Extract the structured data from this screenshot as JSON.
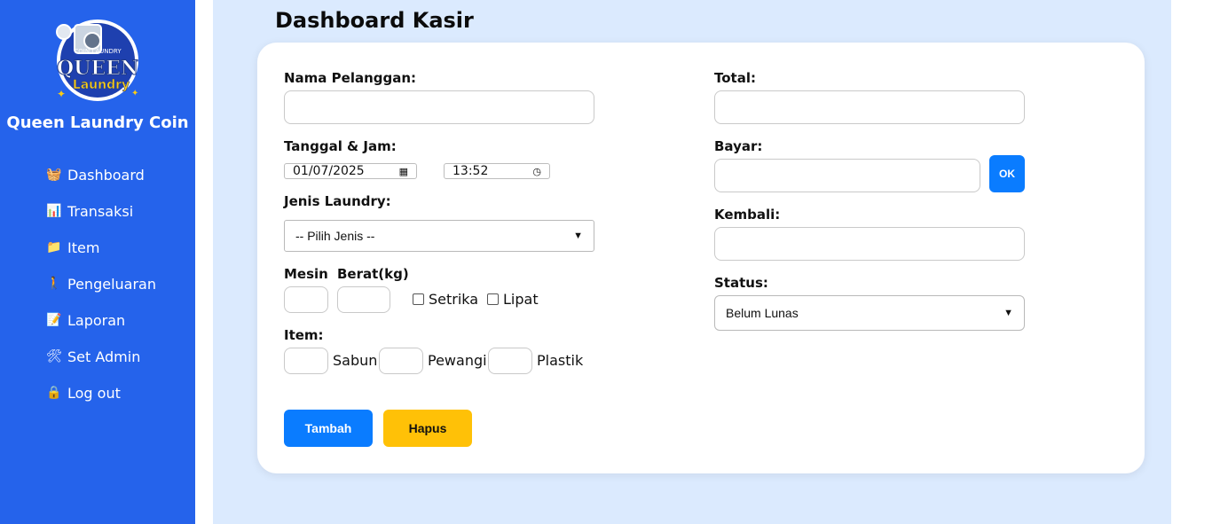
{
  "sidebar": {
    "brand": "Queen Laundry Coin",
    "items": [
      {
        "label": "Dashboard",
        "icon": "washing-basket-icon"
      },
      {
        "label": "Transaksi",
        "icon": "bar-chart-icon"
      },
      {
        "label": "Item",
        "icon": "folder-icon"
      },
      {
        "label": "Pengeluaran",
        "icon": "person-walking-icon"
      },
      {
        "label": "Laporan",
        "icon": "document-icon"
      },
      {
        "label": "Set Admin",
        "icon": "tools-icon"
      },
      {
        "label": "Log out",
        "icon": "lock-icon"
      }
    ],
    "logo": {
      "line1": "COIN LAUNDRY",
      "line2": "QUEEN",
      "line3": "Laundry"
    }
  },
  "page": {
    "title": "Dashboard Kasir"
  },
  "form": {
    "nama_label": "Nama Pelanggan:",
    "nama_value": "",
    "tanggal_label": "Tanggal & Jam:",
    "date_value": "01/07/2025",
    "time_value": "13:52",
    "jenis_label": "Jenis Laundry:",
    "jenis_selected": "-- Pilih Jenis --",
    "mesin_label": "Mesin",
    "berat_label": "Berat(kg)",
    "setrika_label": "Setrika",
    "lipat_label": "Lipat",
    "item_label": "Item:",
    "sabun_label": "Sabun",
    "pewangi_label": "Pewangi",
    "plastik_label": "Plastik",
    "total_label": "Total:",
    "bayar_label": "Bayar:",
    "ok_label": "OK",
    "kembali_label": "Kembali:",
    "status_label": "Status:",
    "status_selected": "Belum Lunas",
    "tambah_label": "Tambah",
    "hapus_label": "Hapus"
  },
  "colors": {
    "sidebar": "#2563eb",
    "background": "#dbeafe",
    "primary": "#0a7cff",
    "warning": "#ffc107"
  }
}
